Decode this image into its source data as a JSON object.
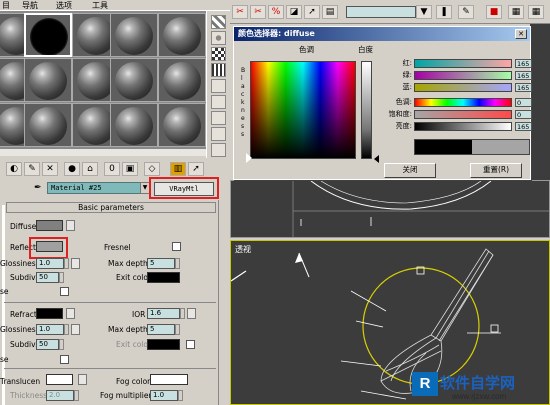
{
  "material_editor": {
    "menu": [
      "目",
      "导航",
      "选项",
      "工具"
    ],
    "material_name": "Material #25",
    "material_type": "VRayMtl",
    "rollout_title": "Basic parameters",
    "diffuse_label": "Diffuse",
    "reflect_label": "Reflect",
    "fresnel_label": "Fresnel",
    "glossiness_label": "Glossiness",
    "glossiness_value": "1.0",
    "max_depth_label": "Max depth",
    "max_depth_value": "5",
    "subdivs_label": "Subdivs",
    "subdivs_value": "50",
    "exit_color_label": "Exit color",
    "use_label": "se",
    "refract_label": "Refract",
    "ior_label": "IOR",
    "ior_value": "1.6",
    "r_glossiness_value": "1.0",
    "r_max_depth_value": "5",
    "r_subdivs_value": "50",
    "r_exit_color_label": "Exit color",
    "use2_label": "se",
    "translucent_label": "Translucen",
    "fog_color_label": "Fog color",
    "thickness_label": "Thickness",
    "thickness_value": "2.0",
    "fog_multiplier_label": "Fog multiplier",
    "fog_multiplier_value": "1.0",
    "colors": {
      "diffuse": "#808080",
      "reflect": "#a0a0a0",
      "refract": "#000000",
      "exit": "#000000",
      "translucent": "#ffffff",
      "fog": "#ffffff"
    }
  },
  "color_dialog": {
    "title": "颜色选择器: diffuse",
    "hue_label": "色调",
    "whiteness_label": "白度",
    "blackness_letters": [
      "B",
      "l",
      "a",
      "c",
      "k",
      "n",
      "e",
      "s",
      "s"
    ],
    "rows": [
      {
        "label": "红:",
        "value": "165"
      },
      {
        "label": "绿:",
        "value": "165"
      },
      {
        "label": "蓝:",
        "value": "165"
      },
      {
        "label": "色调:",
        "value": "0"
      },
      {
        "label": "饱和度:",
        "value": "0"
      },
      {
        "label": "亮度:",
        "value": "165"
      }
    ],
    "close_label": "关闭",
    "reset_label": "重置(R)",
    "current_color": "#a5a5a5"
  },
  "viewport": {
    "persp_label": "透视"
  },
  "watermark": {
    "brand": "软件自学网",
    "url": "www.rjzxw.com"
  }
}
